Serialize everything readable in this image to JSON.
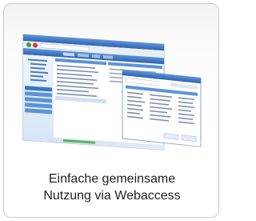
{
  "caption": {
    "line1": "Einfache gemeinsame",
    "line2": "Nutzung via Webaccess"
  },
  "screenshot_image": {
    "description_icon": "webaccess-screenshot-illustration"
  },
  "colors": {
    "window_blue": "#3a76c6",
    "toolbar_blue": "#5b93d8",
    "panel_light": "#eaf2fb",
    "caption_text": "#222222"
  }
}
